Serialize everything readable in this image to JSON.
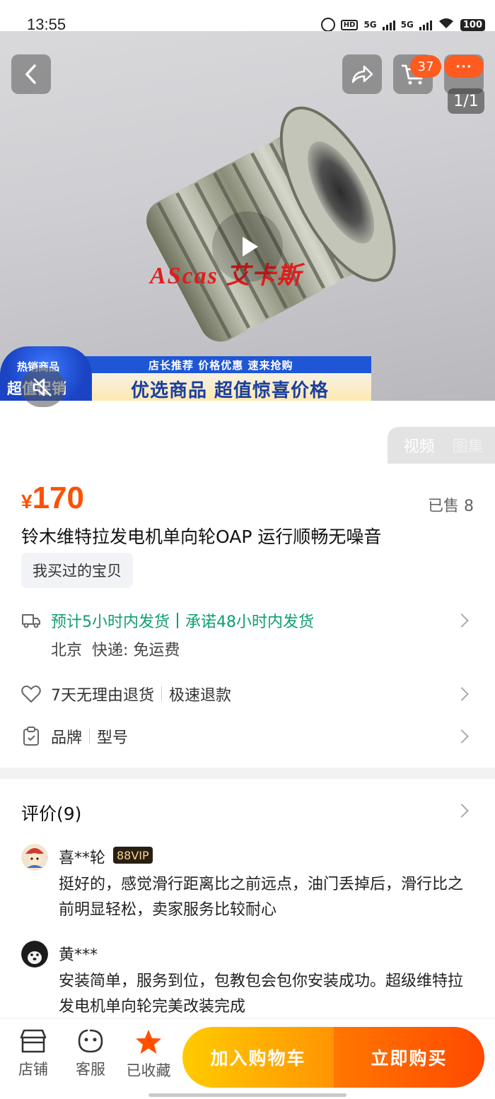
{
  "status_bar": {
    "time": "13:55",
    "hd_label": "HD",
    "net1": "5G",
    "net2": "5G",
    "battery": "100"
  },
  "hero": {
    "watermark": "AScas 艾卡斯",
    "cart_count": "37",
    "more_label": "···",
    "image_counter": "1/1",
    "promo_top": "店长推荐 价格优惠 速来抢购",
    "promo_main": "优选商品 超值惊喜价格",
    "promo_badge_line1": "热销商品",
    "promo_badge_line2": "超值促销"
  },
  "media_tabs": [
    {
      "label": "视频"
    },
    {
      "label": "图集"
    }
  ],
  "product": {
    "currency": "¥",
    "price": "170",
    "sold": "已售 8",
    "title": "铃木维特拉发电机单向轮OAP 运行顺畅无噪音",
    "bought_tag": "我买过的宝贝"
  },
  "shipping": {
    "estimate": "预计5小时内发货",
    "promise": "承诺48小时内发货",
    "origin": "北京",
    "express": "快递: 免运费"
  },
  "returns": {
    "policy": "7天无理由退货",
    "refund": "极速退款"
  },
  "params": {
    "brand": "品牌",
    "model": "型号"
  },
  "reviews": {
    "title": "评价(9)",
    "items": [
      {
        "user": "喜**轮",
        "badge": "88VIP",
        "text": "挺好的，感觉滑行距离比之前远点，油门丢掉后，滑行比之前明显轻松，卖家服务比较耐心"
      },
      {
        "user": "黄***",
        "badge": "",
        "text": "安装简单，服务到位，包教包会包你安装成功。超级维特拉发电机单向轮完美改装完成"
      }
    ]
  },
  "bottom_bar": {
    "shop": "店铺",
    "service": "客服",
    "favorited": "已收藏",
    "add_to_cart": "加入购物车",
    "buy_now": "立即购买"
  },
  "colors": {
    "accent": "#ff5000",
    "green": "#0f9e6e",
    "cart_button": "#ffb300",
    "buy_button": "#ff5a00"
  }
}
